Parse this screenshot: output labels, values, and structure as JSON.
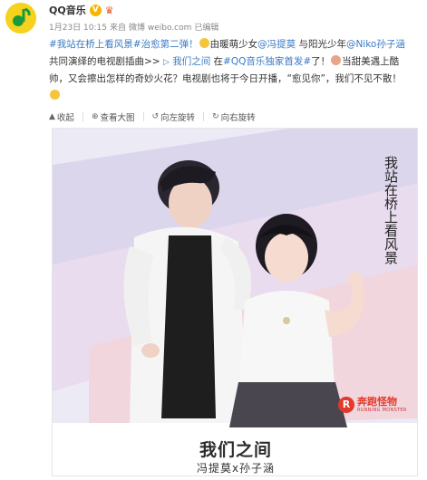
{
  "post": {
    "author": "QQ音乐",
    "verified_badge": "V",
    "member_icon": "crown-icon",
    "timestamp": "1月23日 10:15",
    "source_prefix": "来自",
    "source_site": "微博 weibo.com",
    "edited": "已编辑",
    "content": {
      "line1_link": "#我站在桥上看风景#治愈第二弹！",
      "line1_text_a": "由暖萌少女",
      "line1_mention_a": "@冯提莫",
      "line1_text_b": " 与阳光少年",
      "line1_mention_b": "@Niko孙子涵",
      "line2_text": "共同演绎的电视剧插曲>> ",
      "line2_link": "我们之间",
      "line2_text_b": " 在",
      "line2_topic": "#QQ音乐独家首发#",
      "line2_text_c": "了！",
      "line2_text_d": "当甜美遇上酷",
      "line3_text": "帅，又会擦出怎样的奇妙火花？电视剧也将于今日开播，“愈见你”，我们不见不散！"
    }
  },
  "toolbar": {
    "collapse": "收起",
    "view_large": "查看大图",
    "rotate_left": "向左旋转",
    "rotate_right": "向右旋转"
  },
  "poster": {
    "title": "我们之间",
    "subtitle": "冯提莫x孙子涵",
    "calligraphy": "我站在桥上看风景",
    "brand_cn": "奔跑怪物",
    "brand_en": "RUNNING MONSTER",
    "brand_badge": "R"
  },
  "colors": {
    "link": "#3a7ac5",
    "brand_red": "#e2392a",
    "verified": "#f7b500",
    "avatar": "#f6d21e"
  }
}
